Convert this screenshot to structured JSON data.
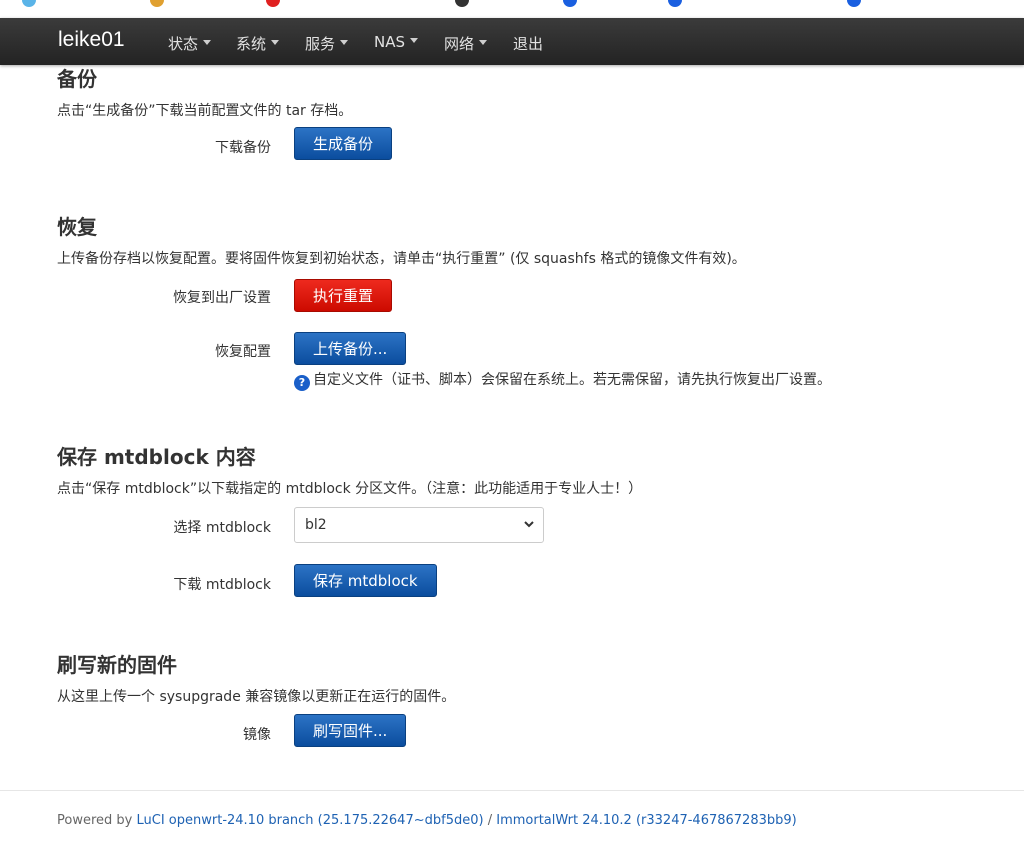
{
  "colors": {
    "navbar": "#2c2c2c",
    "primary_button": "#0b55a8",
    "danger_button": "#e01a10",
    "link": "#1e62b3"
  },
  "navbar": {
    "brand": "leike01",
    "menus": [
      "状态",
      "系统",
      "服务",
      "NAS",
      "网络"
    ],
    "logout": "退出"
  },
  "backup": {
    "title": "备份",
    "description": "点击“生成备份”下载当前配置文件的 tar 存档。",
    "download_label": "下载备份",
    "generate_button": "生成备份"
  },
  "restore": {
    "title": "恢复",
    "description": "上传备份存档以恢复配置。要将固件恢复到初始状态，请单击“执行重置” (仅 squashfs 格式的镜像文件有效)。",
    "factory_label": "恢复到出厂设置",
    "reset_button": "执行重置",
    "restore_label": "恢复配置",
    "upload_button": "上传备份...",
    "help_icon": "question-circle-icon",
    "help_text": "自定义文件（证书、脚本）会保留在系统上。若无需保留，请先执行恢复出厂设置。"
  },
  "mtdblock": {
    "title": "保存 mtdblock 内容",
    "description": "点击“保存 mtdblock”以下载指定的 mtdblock 分区文件。（注意：此功能适用于专业人士！）",
    "select_label": "选择 mtdblock",
    "selected": "bl2",
    "download_label": "下载 mtdblock",
    "save_button": "保存 mtdblock"
  },
  "flash": {
    "title": "刷写新的固件",
    "description": "从这里上传一个 sysupgrade 兼容镜像以更新正在运行的固件。",
    "image_label": "镜像",
    "flash_button": "刷写固件..."
  },
  "footer": {
    "powered_by": "Powered by",
    "luci_link": "LuCI openwrt-24.10 branch (25.175.22647~dbf5de0)",
    "separator": "/",
    "distro_link": "ImmortalWrt 24.10.2 (r33247-467867283bb9)"
  }
}
